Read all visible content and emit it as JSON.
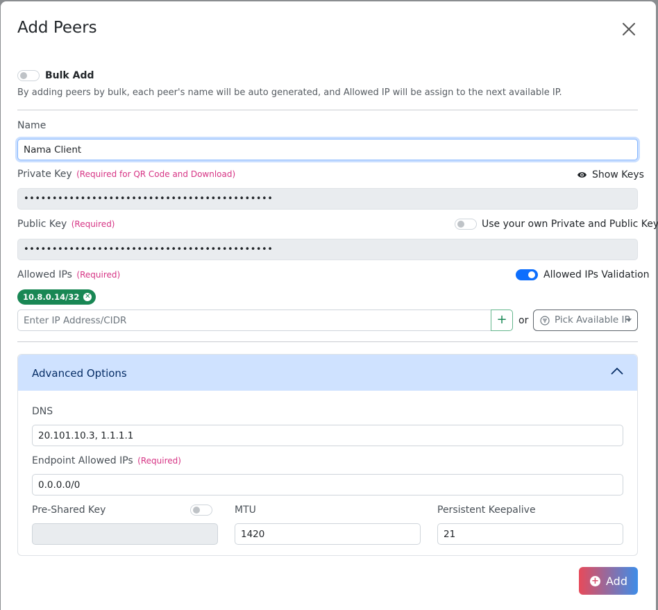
{
  "modal": {
    "title": "Add Peers",
    "close_icon": "close-icon"
  },
  "bulk": {
    "label": "Bulk Add",
    "enabled": false,
    "description": "By adding peers by bulk, each peer's name will be auto generated, and Allowed IP will be assign to the next available IP."
  },
  "name": {
    "label": "Name",
    "value": "Nama Client"
  },
  "private_key": {
    "label": "Private Key",
    "note": "(Required for QR Code and Download)",
    "show_keys_label": "Show Keys",
    "masked_value": "••••••••••••••••••••••••••••••••••••••••••••"
  },
  "public_key": {
    "label": "Public Key",
    "note": "(Required)",
    "own_keys_label": "Use your own Private and Public Key",
    "own_keys_enabled": false,
    "masked_value": "••••••••••••••••••••••••••••••••••••••••••••"
  },
  "allowed_ips": {
    "label": "Allowed IPs",
    "note": "(Required)",
    "validation_label": "Allowed IPs Validation",
    "validation_enabled": true,
    "chips": [
      "10.8.0.14/32"
    ],
    "input_placeholder": "Enter IP Address/CIDR",
    "or_label": "or",
    "pick_label": "Pick Available IP"
  },
  "advanced": {
    "title": "Advanced Options",
    "expanded": true,
    "dns_label": "DNS",
    "dns_value": "20.101.10.3, 1.1.1.1",
    "endpoint_label": "Endpoint Allowed IPs",
    "endpoint_note": "(Required)",
    "endpoint_value": "0.0.0.0/0",
    "psk_label": "Pre-Shared Key",
    "psk_enabled": false,
    "psk_value": "",
    "mtu_label": "MTU",
    "mtu_value": "1420",
    "keepalive_label": "Persistent Keepalive",
    "keepalive_value": "21"
  },
  "footer": {
    "add_label": "Add"
  },
  "colors": {
    "accent": "#0d6efd",
    "required": "#d63384",
    "chip": "#198754",
    "adv_header": "#cfe2ff"
  }
}
